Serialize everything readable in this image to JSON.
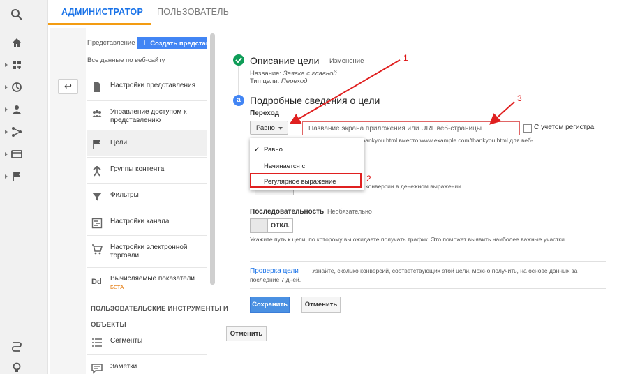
{
  "tabs": {
    "admin": "АДМИНИСТРАТОР",
    "user": "ПОЛЬЗОВАТЕЛЬ"
  },
  "rail": {
    "icons": [
      "search-icon",
      "home-icon",
      "dashboard-icon",
      "clock-icon",
      "user-icon",
      "branch-icon",
      "display-icon",
      "flag-icon",
      "route-icon",
      "lightbulb-icon"
    ]
  },
  "view_column": {
    "label": "Представление",
    "create_button": "Создать представление",
    "all_data": "Все данные по веб-сайту",
    "items": [
      {
        "label": "Настройки представления",
        "icon": "page-icon"
      },
      {
        "label": "Управление доступом к представлению",
        "icon": "people-icon"
      },
      {
        "label": "Цели",
        "icon": "flag-icon"
      },
      {
        "label": "Группы контента",
        "icon": "walk-icon"
      },
      {
        "label": "Фильтры",
        "icon": "filter-icon"
      },
      {
        "label": "Настройки канала",
        "icon": "channel-icon"
      },
      {
        "label": "Настройки электронной торговли",
        "icon": "cart-icon"
      },
      {
        "label": "Вычисляемые показатели",
        "icon": "dd-icon",
        "badge": "БЕТА"
      }
    ],
    "section_title_line1": "ПОЛЬЗОВАТЕЛЬСКИЕ ИНСТРУМЕНТЫ И",
    "section_title_line2": "ОБЪЕКТЫ",
    "tool_items": [
      {
        "label": "Сегменты",
        "icon": "segments-icon"
      },
      {
        "label": "Заметки",
        "icon": "notes-icon"
      }
    ],
    "back_glyph": "↩"
  },
  "goal_description": {
    "title": "Описание цели",
    "edit": "Изменение",
    "name_label": "Название:",
    "name_value": "Заявка с главной",
    "type_label": "Тип цели:",
    "type_value": "Переход"
  },
  "goal_details": {
    "step": "a",
    "title": "Подробные сведения о цели",
    "destination_label": "Переход",
    "match_type": "Равно",
    "destination_placeholder": "Название экрана приложения или URL веб-страницы",
    "case_sensitive": "С учетом регистра",
    "hint": "Например, для экрана приложения и /thankyou.html вместо www.example.com/thankyou.html для веб-",
    "dropdown_options": [
      "Равно",
      "Начинается с",
      "Регулярное выражение"
    ],
    "selected_option": "Равно",
    "value_hint_partial": "ь конверсии в денежном выражении.",
    "sequence_label": "Последовательность",
    "sequence_optional": "Необязательно",
    "toggle_off": "ОТКЛ.",
    "sequence_hint": "Укажите путь к цели, по которому вы ожидаете получать трафик. Это поможет выявить наиболее важные участки.",
    "verify_link": "Проверка цели",
    "verify_text_line1": "Узнайте, сколько конверсий, соответствующих этой цели, можно получить, на основе данных за",
    "verify_text_line2": "последние 7 дней.",
    "save": "Сохранить",
    "cancel": "Отменить"
  },
  "footer": {
    "cancel": "Отменить"
  },
  "annotations": [
    "1",
    "2",
    "3"
  ],
  "colors": {
    "accent": "#1a73e8",
    "tab_underline": "#f39c12",
    "check_green": "#0f9d58",
    "annotation_red": "#e02020",
    "save_blue": "#4a90e2"
  }
}
